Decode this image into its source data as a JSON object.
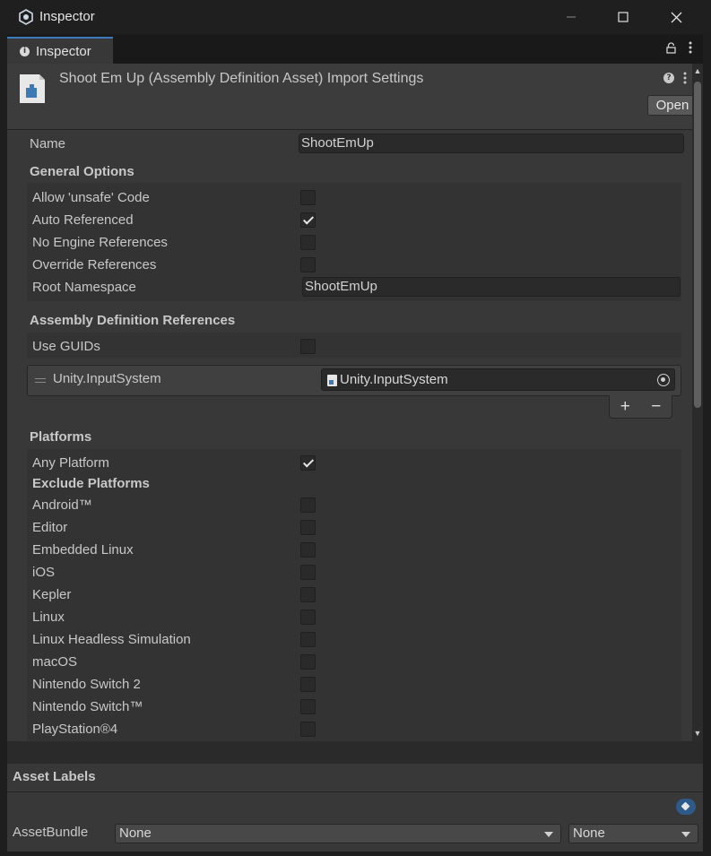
{
  "window": {
    "title": "Inspector"
  },
  "tab": {
    "label": "Inspector"
  },
  "header": {
    "title": "Shoot Em Up (Assembly Definition Asset) Import Settings",
    "open_label": "Open"
  },
  "name_field": {
    "label": "Name",
    "value": "ShootEmUp"
  },
  "general_options": {
    "title": "General Options",
    "items": [
      {
        "label": "Allow 'unsafe' Code",
        "checked": false
      },
      {
        "label": "Auto Referenced",
        "checked": true
      },
      {
        "label": "No Engine References",
        "checked": false
      },
      {
        "label": "Override References",
        "checked": false
      }
    ],
    "root_namespace": {
      "label": "Root Namespace",
      "value": "ShootEmUp"
    }
  },
  "references": {
    "title": "Assembly Definition References",
    "use_guids": {
      "label": "Use GUIDs",
      "checked": false
    },
    "items": [
      {
        "label": "Unity.InputSystem",
        "object": "Unity.InputSystem"
      }
    ],
    "add_label": "+",
    "remove_label": "−"
  },
  "platforms": {
    "title": "Platforms",
    "any_platform": {
      "label": "Any Platform",
      "checked": true
    },
    "exclude_title": "Exclude Platforms",
    "items": [
      {
        "label": "Android™",
        "checked": false
      },
      {
        "label": "Editor",
        "checked": false
      },
      {
        "label": "Embedded Linux",
        "checked": false
      },
      {
        "label": "iOS",
        "checked": false
      },
      {
        "label": "Kepler",
        "checked": false
      },
      {
        "label": "Linux",
        "checked": false
      },
      {
        "label": "Linux Headless Simulation",
        "checked": false
      },
      {
        "label": "macOS",
        "checked": false
      },
      {
        "label": "Nintendo Switch 2",
        "checked": false
      },
      {
        "label": "Nintendo Switch™",
        "checked": false
      },
      {
        "label": "PlayStation®4",
        "checked": false
      }
    ]
  },
  "footer": {
    "asset_labels_title": "Asset Labels",
    "assetbundle_label": "AssetBundle",
    "bundle_value": "None",
    "variant_value": "None"
  },
  "icons": [
    "unity-logo-icon",
    "minimize-icon",
    "maximize-icon",
    "close-icon",
    "info-icon",
    "lock-icon",
    "kebab-menu-icon",
    "asset-file-icon",
    "help-icon",
    "tag-icon"
  ]
}
